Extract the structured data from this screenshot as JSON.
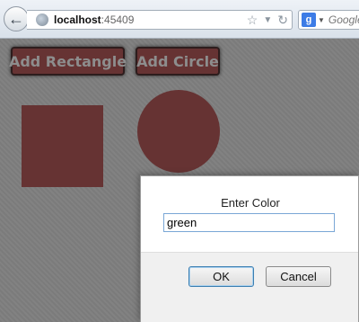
{
  "browser": {
    "url_host": "localhost",
    "url_port": ":45409",
    "search_engine_letter": "g",
    "search_placeholder": "Google",
    "icons": [
      "back-arrow-icon",
      "globe-icon",
      "star-icon",
      "dropdown-icon",
      "reload-icon",
      "google-icon"
    ]
  },
  "page": {
    "buttons": {
      "add_rectangle": "Add Rectangle",
      "add_circle": "Add Circle"
    },
    "shape_color": "#663333",
    "background_color": "#7e7e7e"
  },
  "dialog": {
    "message": "Enter Color",
    "input_value": "green",
    "ok_label": "OK",
    "cancel_label": "Cancel"
  }
}
